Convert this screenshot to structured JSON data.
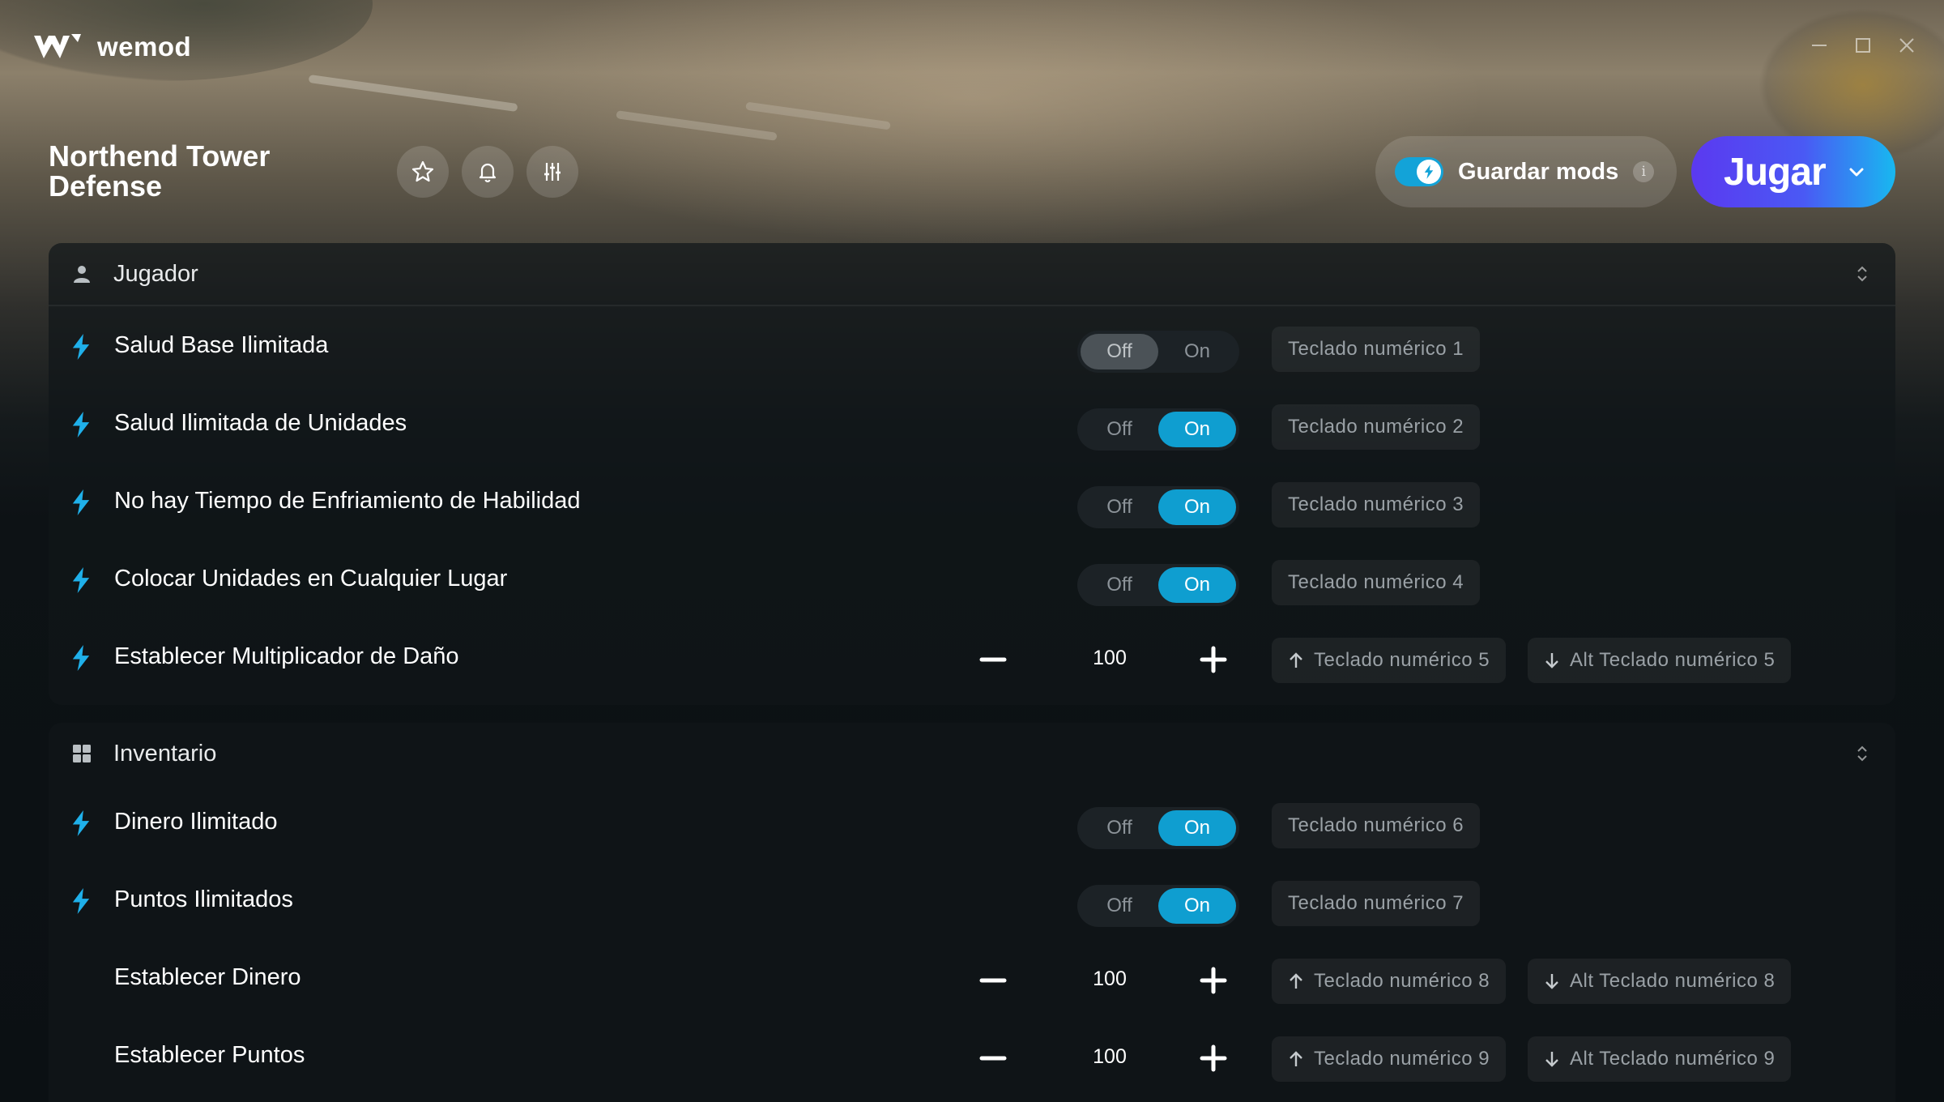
{
  "app": {
    "name": "wemod"
  },
  "game": {
    "title": "Northend Tower Defense"
  },
  "header": {
    "save_mods_label": "Guardar mods",
    "save_mods_info": "i",
    "play_label": "Jugar"
  },
  "colors": {
    "accent_blue": "#0f9ed0",
    "play_gradient_start": "#5b39f0",
    "play_gradient_end": "#18b8f0",
    "bolt": "#1fb0ea"
  },
  "icons": {
    "header": [
      "star-icon",
      "bell-icon",
      "sliders-icon"
    ],
    "categories": [
      "person-icon",
      "grid-icon"
    ]
  },
  "toggle_labels": {
    "off": "Off",
    "on": "On"
  },
  "categories": [
    {
      "label": "Jugador",
      "mods": [
        {
          "label": "Salud Base Ilimitada",
          "type": "toggle",
          "state": "off",
          "hotkey": "Teclado numérico 1"
        },
        {
          "label": "Salud Ilimitada de Unidades",
          "type": "toggle",
          "state": "on",
          "hotkey": "Teclado numérico 2"
        },
        {
          "label": "No hay Tiempo de Enfriamiento de Habilidad",
          "type": "toggle",
          "state": "on",
          "hotkey": "Teclado numérico 3"
        },
        {
          "label": "Colocar Unidades en Cualquier Lugar",
          "type": "toggle",
          "state": "on",
          "hotkey": "Teclado numérico 4"
        },
        {
          "label": "Establecer Multiplicador de Daño",
          "type": "number",
          "value": "100",
          "hotkey_up": "Teclado numérico 5",
          "hotkey_down": "Alt Teclado numérico 5"
        }
      ]
    },
    {
      "label": "Inventario",
      "mods": [
        {
          "label": "Dinero Ilimitado",
          "type": "toggle",
          "state": "on",
          "hotkey": "Teclado numérico 6"
        },
        {
          "label": "Puntos Ilimitados",
          "type": "toggle",
          "state": "on",
          "hotkey": "Teclado numérico 7"
        },
        {
          "label": "Establecer Dinero",
          "type": "number",
          "value": "100",
          "hotkey_up": "Teclado numérico 8",
          "hotkey_down": "Alt Teclado numérico 8"
        },
        {
          "label": "Establecer Puntos",
          "type": "number",
          "value": "100",
          "hotkey_up": "Teclado numérico 9",
          "hotkey_down": "Alt Teclado numérico 9"
        }
      ]
    }
  ]
}
